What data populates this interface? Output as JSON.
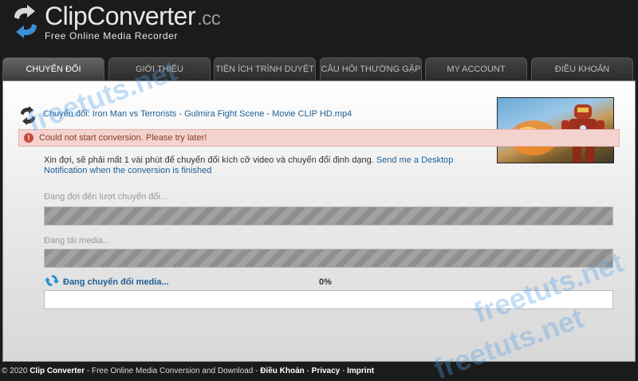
{
  "header": {
    "logo_text": "ClipConverter",
    "logo_suffix": ".cc",
    "tagline": "Free Online Media Recorder"
  },
  "tabs": [
    {
      "label": "CHUYỂN ĐỔI"
    },
    {
      "label": "GIỚI THIỆU"
    },
    {
      "label": "TIỆN ÍCH TRÌNH DUYỆT"
    },
    {
      "label": "CÂU HỎI THƯỜNG GẶP"
    },
    {
      "label": "MY ACCOUNT"
    },
    {
      "label": "ĐIỀU KHOẢN"
    }
  ],
  "conversion": {
    "title": "Chuyển đổi: Iron Man vs Terrorists - Gulmira Fight Scene - Movie CLIP HD.mp4",
    "alert": "Could not start conversion. Please try later!",
    "info": "Xin đợi, sẽ phải mất 1 vài phút để chuyển đổi kích cỡ video và chuyển đổi định dạng.",
    "notify_link": "Send me a Desktop Notification when the conversion is finished",
    "steps": [
      {
        "label": "Đang đợi đến lượt chuyển đổi..."
      },
      {
        "label": "Đang tải media..."
      },
      {
        "label": "Đang chuyển đổi media..."
      }
    ],
    "progress_text": "0%",
    "progress": 0
  },
  "watermarks": [
    "freetuts.net",
    "freetuts.net",
    "freetuts.net"
  ],
  "footer": {
    "copyright": "© 2020",
    "brand": "Clip Converter",
    "desc": " - Free Online Media Conversion and Download - ",
    "terms": "Điều Khoản",
    "sep": " - ",
    "privacy": "Privacy",
    "imprint": "Imprint"
  },
  "colors": {
    "background": "#1b1b1b",
    "link": "#1f5f95",
    "alert_bg": "#f4d3cf"
  },
  "icons": [
    "convert-arrows-icon",
    "alert-icon",
    "refresh-icon"
  ]
}
